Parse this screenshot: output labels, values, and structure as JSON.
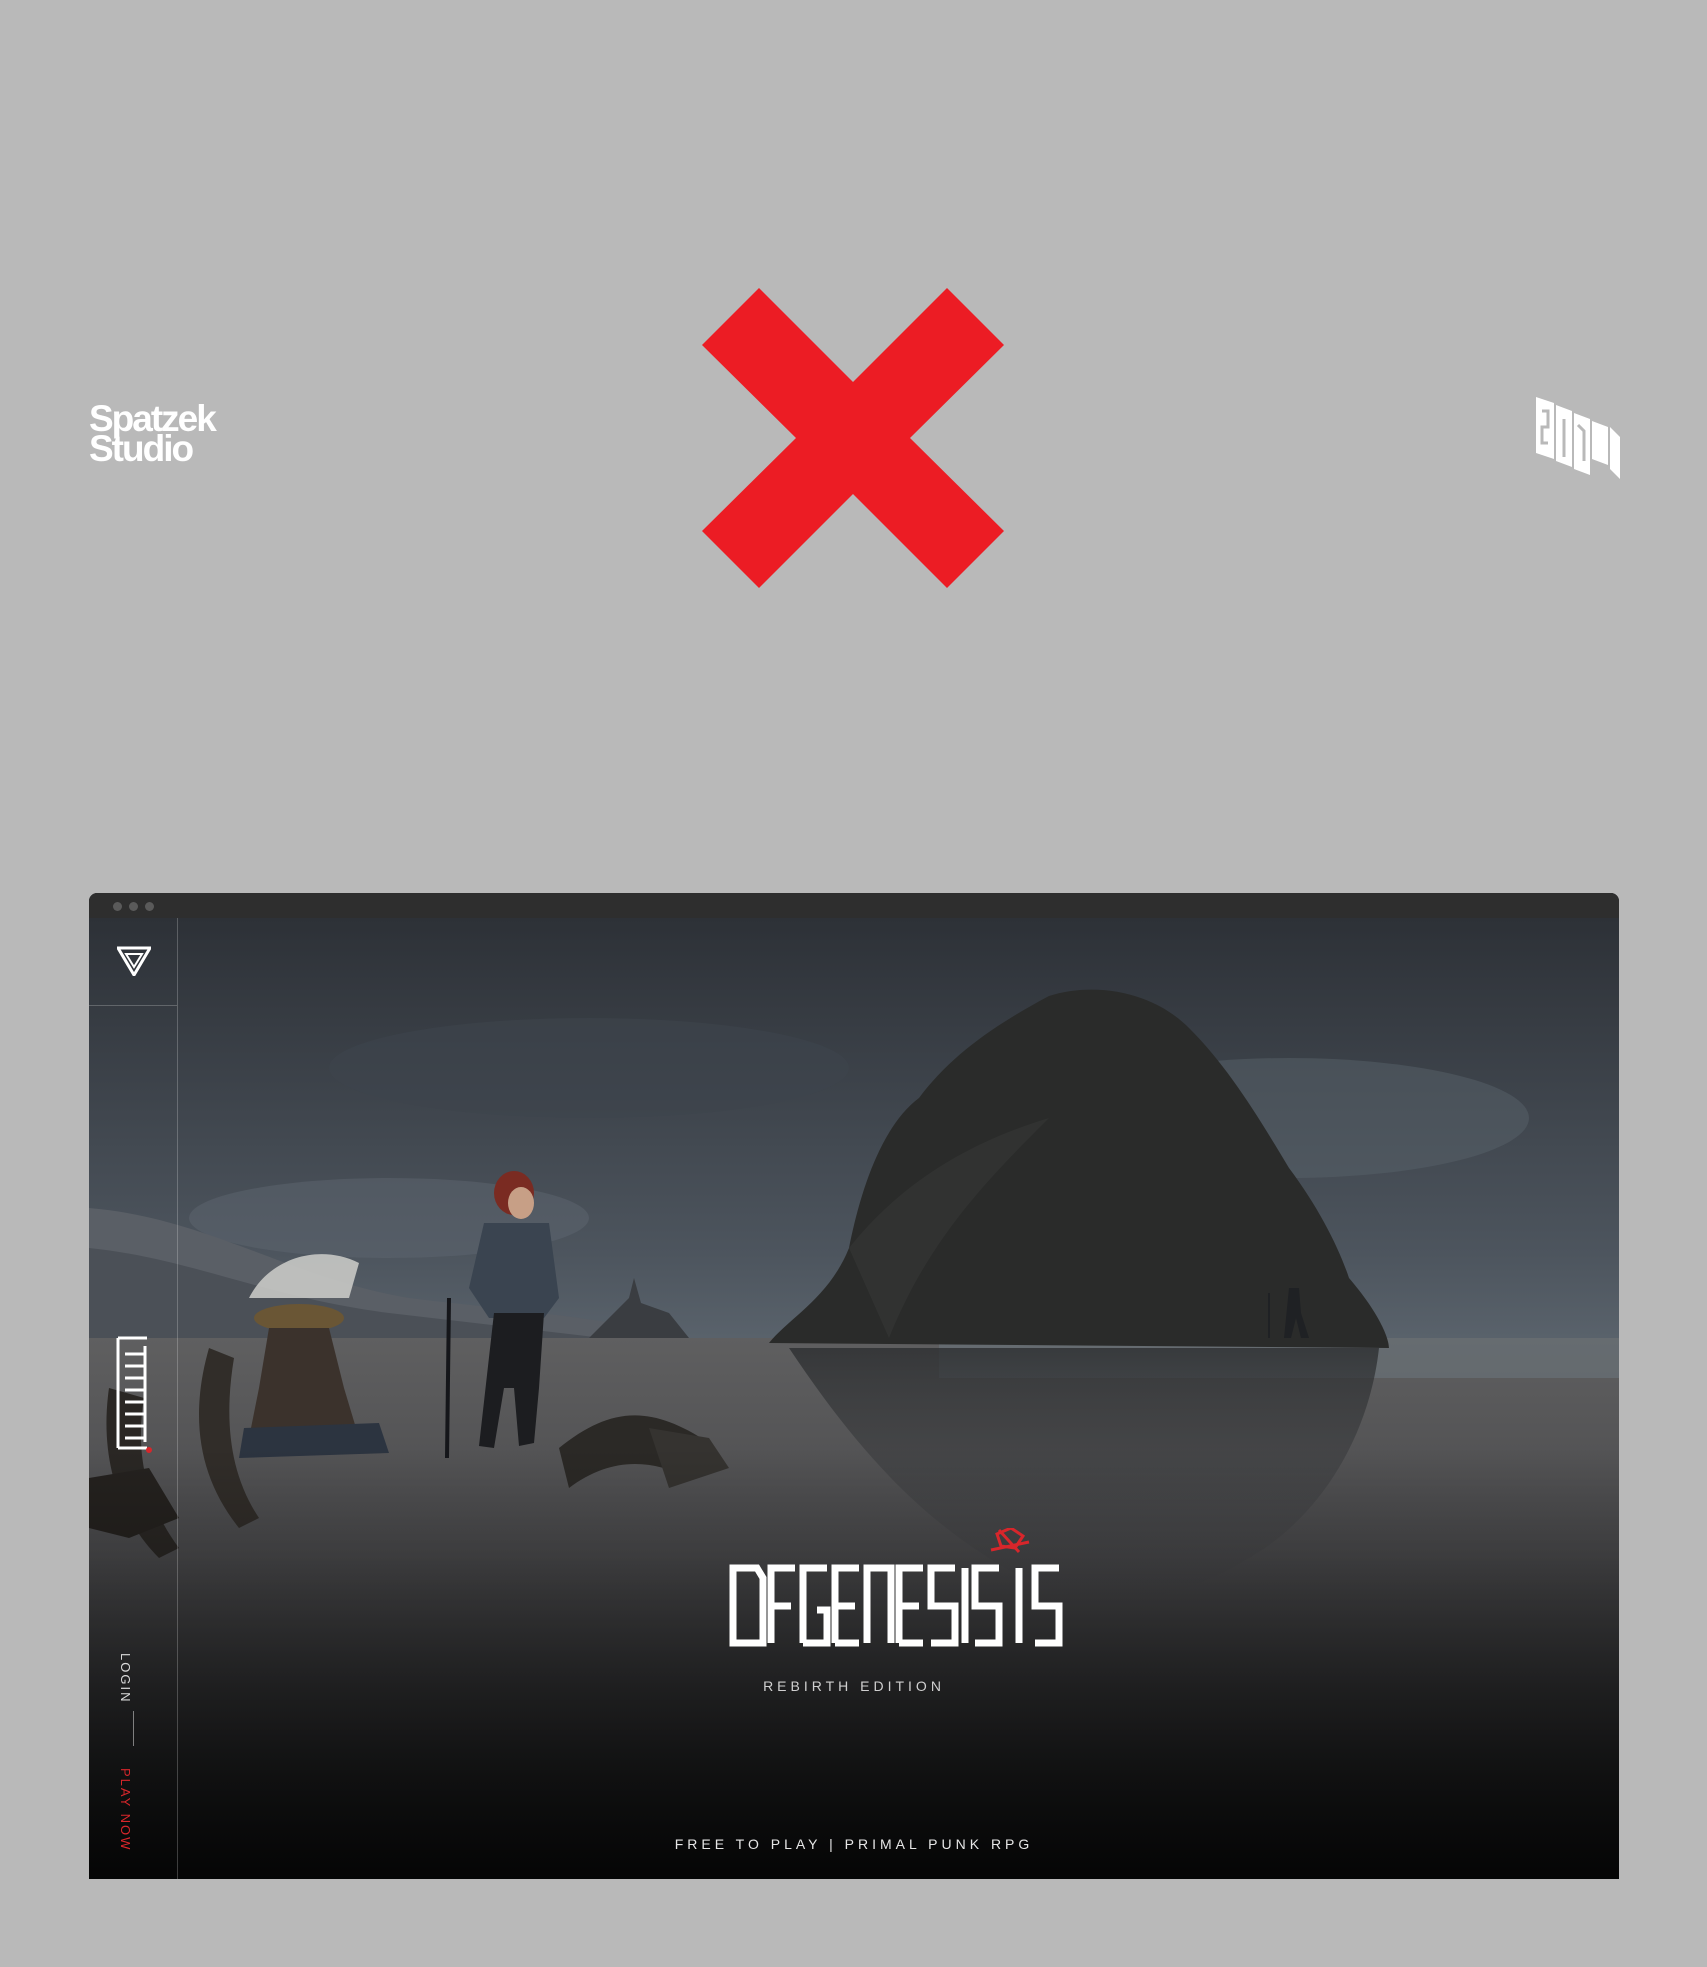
{
  "banner": {
    "studio_line1": "Spatzek",
    "studio_line2": "Studio",
    "separator_icon": "cross-icon",
    "partner_icon": "sixmorevodka-logo-icon",
    "cross_color": "#ec1c24"
  },
  "browser": {
    "window_controls": [
      "dot",
      "dot",
      "dot"
    ]
  },
  "site": {
    "sidebar": {
      "logo_icon": "degenesis-triangle-icon",
      "wordmark": "DEGENESIS",
      "login": "LOGIN",
      "play_now": "PLAY NOW"
    },
    "hero": {
      "title": "DEGENESIS",
      "subtitle": "REBIRTH EDITION",
      "tagline": "FREE TO PLAY | PRIMAL PUNK RPG"
    },
    "accent": "#d8262b"
  }
}
